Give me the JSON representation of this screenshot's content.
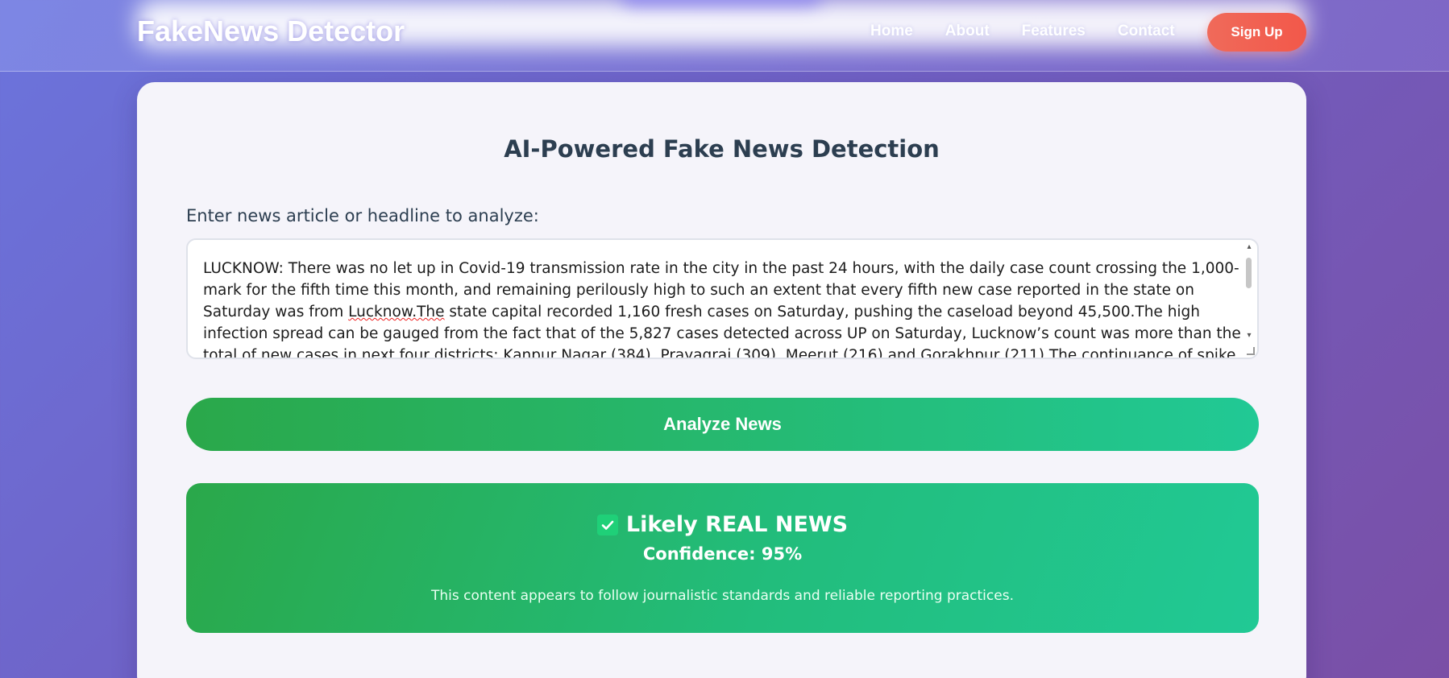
{
  "header": {
    "logo": "FakeNews Detector",
    "nav": [
      "Home",
      "About",
      "Features",
      "Contact"
    ],
    "signup_label": "Sign Up"
  },
  "main": {
    "title": "AI-Powered Fake News Detection",
    "input_label": "Enter news article or headline to analyze:",
    "article_before_mark": "LUCKNOW: There was no let up in Covid-19 transmission rate in the city in the past 24 hours, with the daily case count crossing the 1,000-mark for the fifth time this month, and remaining perilously high to such an extent that every fifth new case reported in the state on Saturday was from ",
    "article_marked": "Lucknow.The",
    "article_after_mark": " state capital recorded 1,160 fresh cases on Saturday, pushing the caseload beyond 45,500.The high infection spread can be gauged from the fact that of the 5,827 cases detected across UP on Saturday, Lucknow’s count was more than the total of new cases in next four districts: Kanpur Nagar (384), Prayagraj (309), Meerut (216) and Gorakhpur (211).The continuance of spike led to further increase in the",
    "analyze_label": "Analyze News"
  },
  "result": {
    "verdict": "Likely REAL NEWS",
    "confidence": "Confidence: 95%",
    "description": "This content appears to follow journalistic standards and reliable reporting practices.",
    "accent_color": "#21c995"
  }
}
